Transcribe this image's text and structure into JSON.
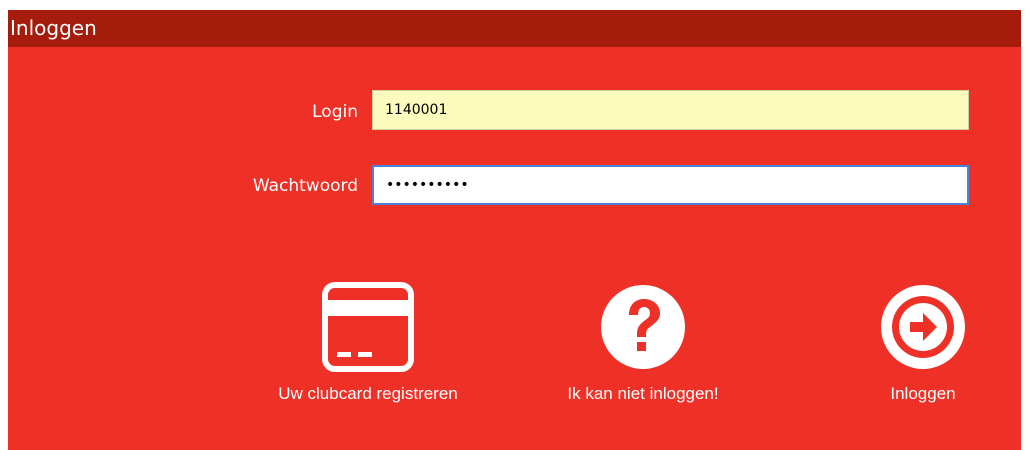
{
  "window": {
    "title": "Inloggen"
  },
  "form": {
    "login_label": "Login",
    "login_value": "1140001",
    "password_label": "Wachtwoord",
    "password_value": "••••••••••"
  },
  "actions": [
    {
      "label": "Uw clubcard registreren",
      "icon": "card-icon"
    },
    {
      "label": "Ik kan niet inloggen!",
      "icon": "question-icon"
    },
    {
      "label": "Inloggen",
      "icon": "arrow-right-icon"
    }
  ],
  "colors": {
    "background": "#ee3026",
    "titlebar": "#a51b0c",
    "login_field": "#fbfbbd",
    "focus_border": "#4a82d6"
  }
}
